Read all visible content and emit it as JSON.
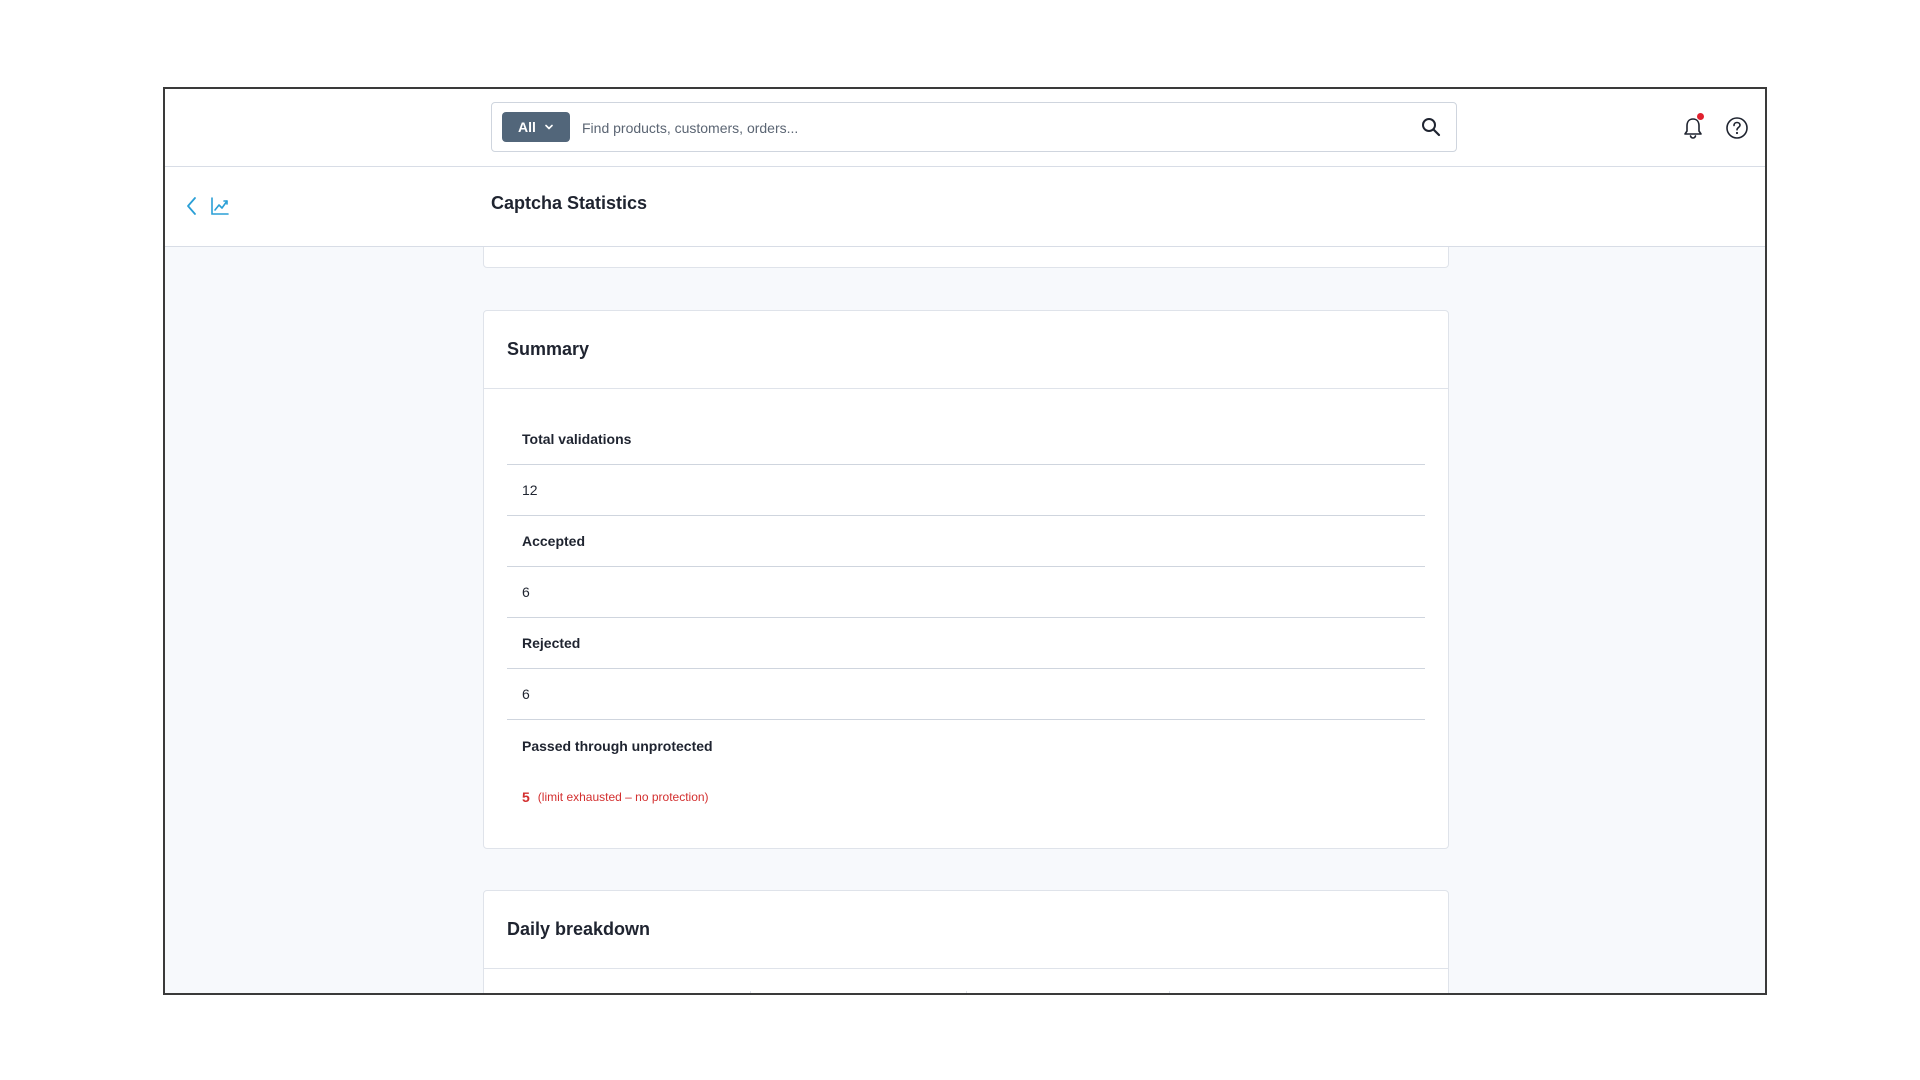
{
  "search": {
    "scope_label": "All",
    "placeholder": "Find products, customers, orders..."
  },
  "header": {
    "page_title": "Captcha Statistics"
  },
  "summary": {
    "title": "Summary",
    "rows": [
      {
        "label": "Total validations",
        "value": "12"
      },
      {
        "label": "Accepted",
        "value": "6"
      },
      {
        "label": "Rejected",
        "value": "6"
      },
      {
        "label": "Passed through unprotected",
        "value": "5",
        "note": "(limit exhausted – no protection)"
      }
    ]
  },
  "daily": {
    "title": "Daily breakdown"
  },
  "colors": {
    "accent": "#2a9fd6",
    "scope_bg": "#52667a",
    "warning": "#d32f2f",
    "notification_dot": "#e0202e"
  },
  "icons": {
    "search": "search-icon",
    "bell": "bell-icon",
    "help": "help-circle-icon",
    "back": "chevron-left-icon",
    "chart": "line-chart-icon",
    "dropdown": "chevron-down-icon"
  }
}
